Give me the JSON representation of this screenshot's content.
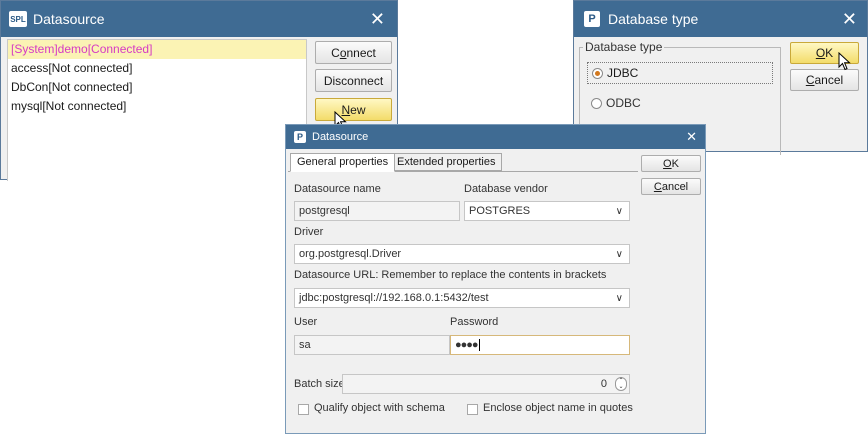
{
  "datasource_window": {
    "title": "Datasource",
    "app_icon_text": "SPL",
    "close_glyph": "✕",
    "items": [
      {
        "label": "[System]demo[Connected]",
        "selected": true
      },
      {
        "label": "access[Not connected]",
        "selected": false
      },
      {
        "label": "DbCon[Not connected]",
        "selected": false
      },
      {
        "label": "mysql[Not connected]",
        "selected": false
      }
    ],
    "buttons": {
      "connect": {
        "pre": "C",
        "underline": "o",
        "post": "nnect"
      },
      "disconnect": {
        "label": "Disconnect"
      },
      "new": {
        "pre": "",
        "underline": "N",
        "post": "ew"
      }
    }
  },
  "database_type_window": {
    "title": "Database type",
    "app_icon_text": "P",
    "close_glyph": "✕",
    "group_label": "Database type",
    "options": [
      {
        "label": "JDBC",
        "checked": true
      },
      {
        "label": "ODBC",
        "checked": false
      }
    ],
    "buttons": {
      "ok": {
        "pre": "",
        "underline": "O",
        "post": "K"
      },
      "cancel": {
        "pre": "",
        "underline": "C",
        "post": "ancel"
      }
    }
  },
  "properties_window": {
    "title": "Datasource",
    "app_icon_text": "P",
    "close_glyph": "✕",
    "tabs": [
      {
        "label": "General properties",
        "active": true
      },
      {
        "label": "Extended properties",
        "active": false
      }
    ],
    "buttons": {
      "ok": {
        "pre": "",
        "underline": "O",
        "post": "K"
      },
      "cancel": {
        "pre": "",
        "underline": "C",
        "post": "ancel"
      }
    },
    "fields": {
      "datasource_name": {
        "label": "Datasource name",
        "value": "postgresql"
      },
      "database_vendor": {
        "label": "Database vendor",
        "value": "POSTGRES"
      },
      "driver": {
        "label": "Driver",
        "value": "org.postgresql.Driver"
      },
      "url": {
        "label": "Datasource URL: Remember to replace the contents in brackets",
        "value": "jdbc:postgresql://192.168.0.1:5432/test"
      },
      "user": {
        "label": "User",
        "value": "sa"
      },
      "password": {
        "label": "Password",
        "value": "●●●●"
      },
      "batch_size": {
        "label": "Batch size",
        "value": "0"
      }
    },
    "checkboxes": {
      "qualify_schema": {
        "label": "Qualify object with schema",
        "checked": false
      },
      "enclose_quotes": {
        "label": "Enclose object name in quotes",
        "checked": false
      }
    },
    "dropdown_glyph": "∨"
  }
}
